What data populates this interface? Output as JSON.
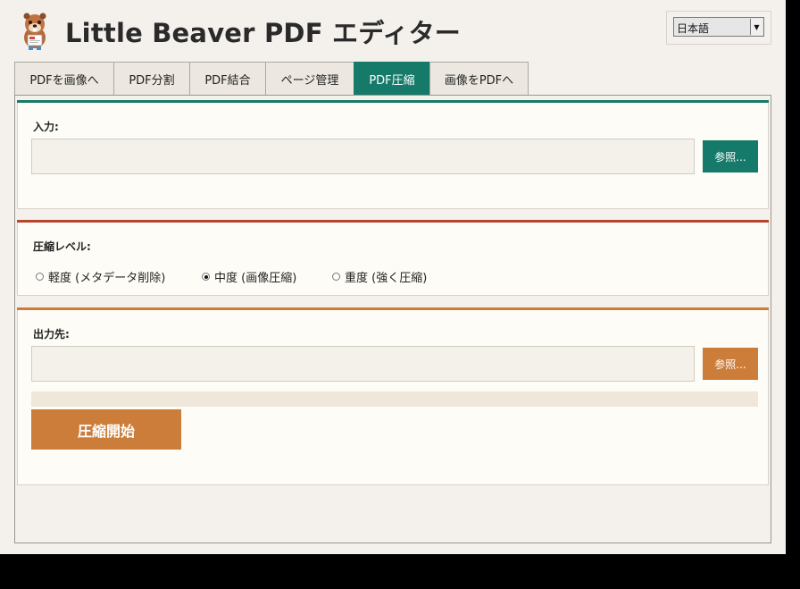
{
  "header": {
    "title": "Little Beaver PDF エディター",
    "logo_icon": "beaver-mascot-icon"
  },
  "language": {
    "selected": "日本語",
    "arrow_icon": "chevron-down-icon"
  },
  "tabs": [
    {
      "label": "PDFを画像へ",
      "active": false
    },
    {
      "label": "PDF分割",
      "active": false
    },
    {
      "label": "PDF結合",
      "active": false
    },
    {
      "label": "ページ管理",
      "active": false
    },
    {
      "label": "PDF圧縮",
      "active": true
    },
    {
      "label": "画像をPDFへ",
      "active": false
    }
  ],
  "input_section": {
    "label": "入力:",
    "value": "",
    "browse_label": "参照..."
  },
  "level_section": {
    "label": "圧縮レベル:",
    "options": [
      {
        "label": "軽度 (メタデータ削除)",
        "selected": false
      },
      {
        "label": "中度 (画像圧縮)",
        "selected": true
      },
      {
        "label": "重度 (強く圧縮)",
        "selected": false
      }
    ]
  },
  "output_section": {
    "label": "出力先:",
    "value": "",
    "browse_label": "参照...",
    "progress": 0,
    "start_label": "圧縮開始"
  },
  "colors": {
    "teal": "#167a6a",
    "red": "#b5452f",
    "orange": "#cc7d3a",
    "background": "#f4f1ec",
    "section_bg": "#fdfcf6"
  }
}
